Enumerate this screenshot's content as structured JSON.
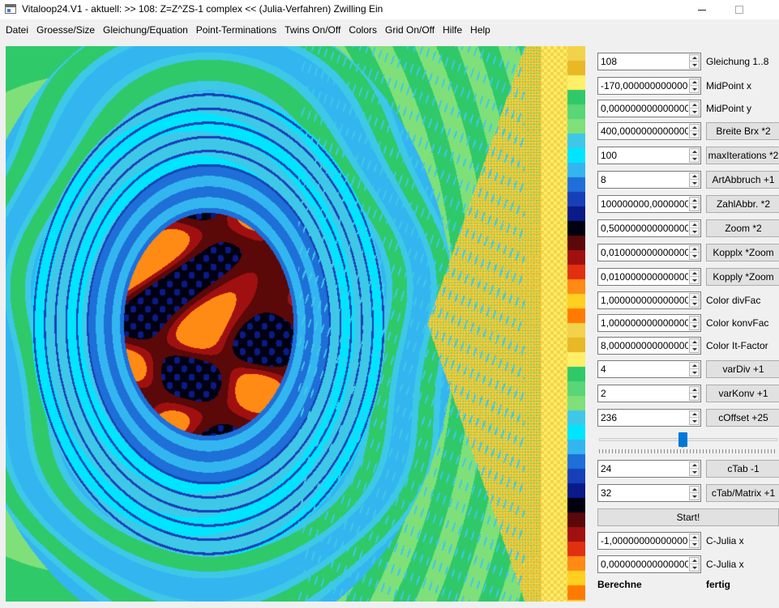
{
  "window": {
    "title": "Vitaloop24.V1 - aktuell: >> 108: Z=Z^ZS-1 complex <<  (Julia-Verfahren)  Zwilling Ein"
  },
  "menu": [
    "Datei",
    "Groesse/Size",
    "Gleichung/Equation",
    "Point-Terminations",
    "Twins On/Off",
    "Colors",
    "Grid On/Off",
    "Hilfe",
    "Help"
  ],
  "controls": [
    {
      "value": "108",
      "label": "Gleichung 1..8",
      "kind": "label"
    },
    {
      "value": "-170,000000000000000",
      "label": "MidPoint x",
      "kind": "label"
    },
    {
      "value": "0,0000000000000000",
      "label": "MidPoint y",
      "kind": "label"
    },
    {
      "value": "400,000000000000000",
      "label": "Breite Brx *2",
      "kind": "button"
    },
    {
      "value": "100",
      "label": "maxIterations *2",
      "kind": "button"
    },
    {
      "value": "8",
      "label": "ArtAbbruch +1",
      "kind": "button"
    },
    {
      "value": "100000000,000000000",
      "label": "ZahlAbbr. *2",
      "kind": "button"
    },
    {
      "value": "0,5000000000000000",
      "label": "Zoom *2",
      "kind": "button"
    },
    {
      "value": "0,0100000000000000",
      "label": "Kopplx *Zoom",
      "kind": "button"
    },
    {
      "value": "0,0100000000000000",
      "label": "Kopply *Zoom",
      "kind": "button"
    },
    {
      "value": "1,0000000000000000",
      "label": "Color divFac",
      "kind": "label"
    },
    {
      "value": "1,0000000000000000",
      "label": "Color konvFac",
      "kind": "label"
    },
    {
      "value": "8,0000000000000000",
      "label": "Color It-Factor",
      "kind": "label"
    },
    {
      "value": "4",
      "label": "varDiv +1",
      "kind": "button"
    },
    {
      "value": "2",
      "label": "varKonv +1",
      "kind": "button"
    },
    {
      "value": "236",
      "label": "cOffset +25",
      "kind": "button"
    }
  ],
  "slider": {
    "value_fraction": 0.47
  },
  "controls2": [
    {
      "value": "24",
      "label": "cTab -1",
      "kind": "button"
    },
    {
      "value": "32",
      "label": "cTab/Matrix +1",
      "kind": "button"
    }
  ],
  "start_label": "Start!",
  "controls3": [
    {
      "value": "-1,0000000000000000",
      "label": "C-Julia x",
      "kind": "label"
    },
    {
      "value": "0,0000000000000000",
      "label": "C-Julia x",
      "kind": "label"
    }
  ],
  "status": {
    "left": "Berechne",
    "right": "fertig"
  },
  "colors": {
    "palette": [
      "#f2d24a",
      "#e8b826",
      "#ffef66",
      "#2fc96a",
      "#59d676",
      "#7fe07a",
      "#3ec8e8",
      "#00e5ff",
      "#33b6f0",
      "#1e6fd8",
      "#1740b8",
      "#0a1a88",
      "#000010",
      "#5a0808",
      "#a01010",
      "#e03010",
      "#ff8a14",
      "#ffd020",
      "#ff7a00"
    ]
  }
}
